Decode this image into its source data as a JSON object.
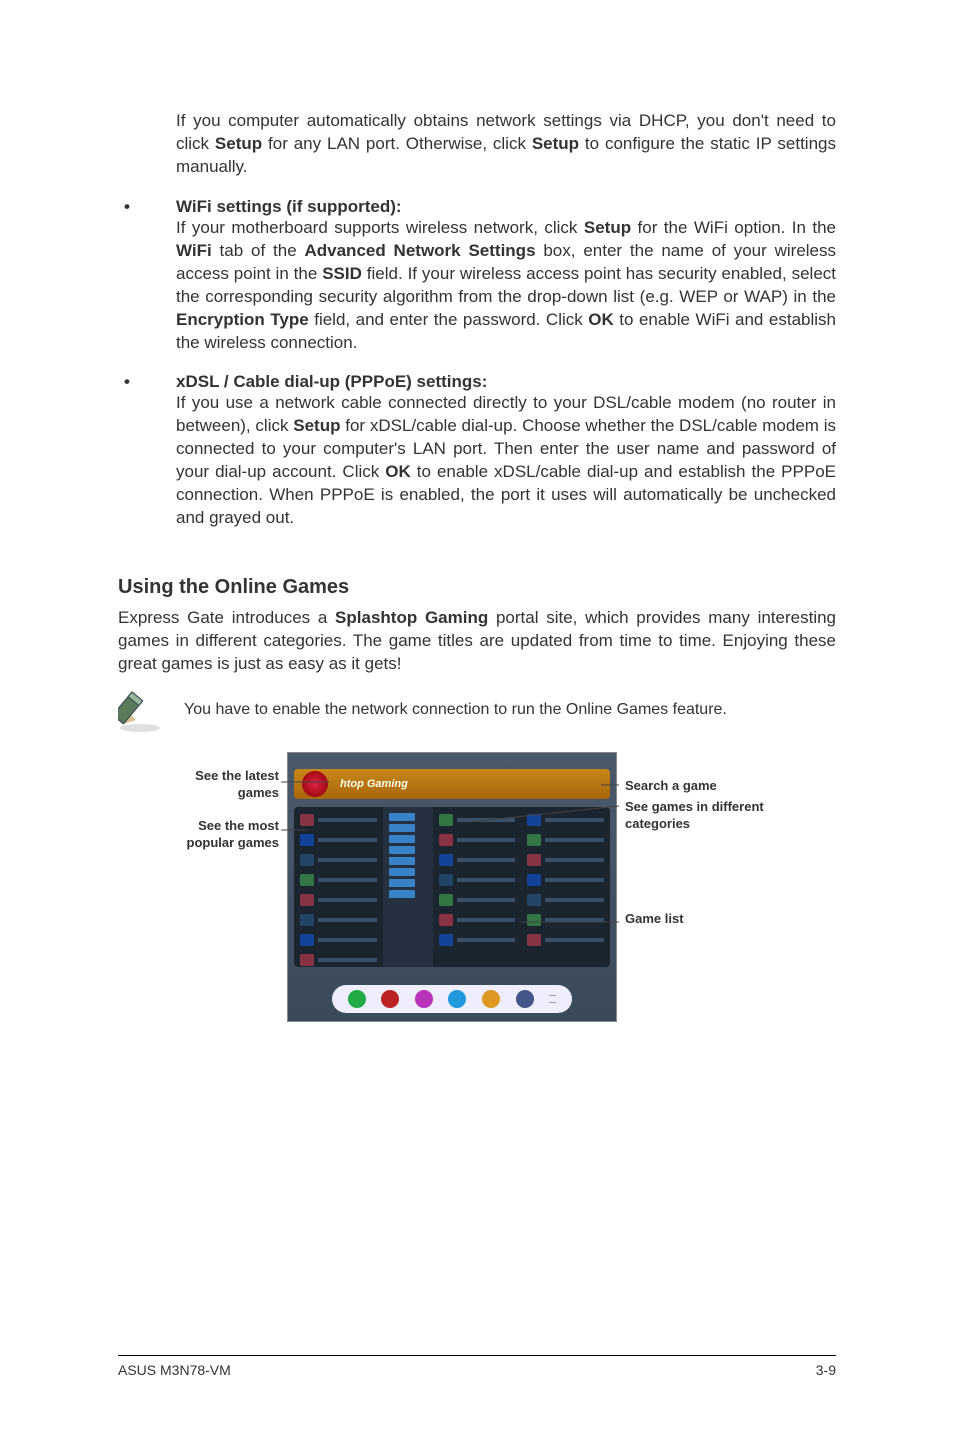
{
  "p1": {
    "t1": "If you computer automatically obtains network settings via DHCP, you don't need to click ",
    "b1": "Setup",
    "t2": " for any LAN port. Otherwise, click ",
    "b2": "Setup",
    "t3": " to configure the static IP settings manually."
  },
  "wifi": {
    "head": "WiFi settings (if supported):",
    "t1": "If your motherboard supports wireless network, click ",
    "b1": "Setup",
    "t2": " for the WiFi option. In the ",
    "b2": "WiFi",
    "t3": " tab of the ",
    "b3": "Advanced Network Settings",
    "t4": " box, enter the name of your wireless access point in the ",
    "b4": "SSID",
    "t5": " field. If your wireless access point has security enabled, select the corresponding security algorithm from the drop-down list (e.g. WEP or WAP) in the ",
    "b5": "Encryption Type",
    "t6": " field, and enter the password. Click ",
    "b6": "OK",
    "t7": " to enable WiFi and establish the wireless connection."
  },
  "xdsl": {
    "head": "xDSL / Cable dial-up (PPPoE) settings:",
    "t1": "If you use a network cable connected directly to your DSL/cable modem (no router in between), click ",
    "b1": "Setup",
    "t2": " for xDSL/cable dial-up. Choose whether the DSL/cable modem is connected to your computer's LAN port. Then enter the user name and password of your dial-up account. Click ",
    "b2": "OK",
    "t3": " to enable xDSL/cable dial-up and establish the PPPoE connection. When PPPoE is enabled, the port it uses will automatically be unchecked and grayed out."
  },
  "games": {
    "head": "Using the Online Games",
    "t1": "Express Gate introduces a ",
    "b1": "Splashtop Gaming",
    "t2": " portal site, which provides many interesting games in different categories. The game titles are updated from time to time. Enjoying these great games is just as easy as it gets!"
  },
  "note": "You have to enable the network connection to run the Online Games feature.",
  "labels": {
    "l1": "See the latest games",
    "l2": "See the most popular games",
    "r1": "Search a game",
    "r2": "See games in different categories",
    "r3": "Game list"
  },
  "shot": {
    "banner": "htop Gaming"
  },
  "footer": {
    "left": "ASUS M3N78-VM",
    "right": "3-9"
  }
}
